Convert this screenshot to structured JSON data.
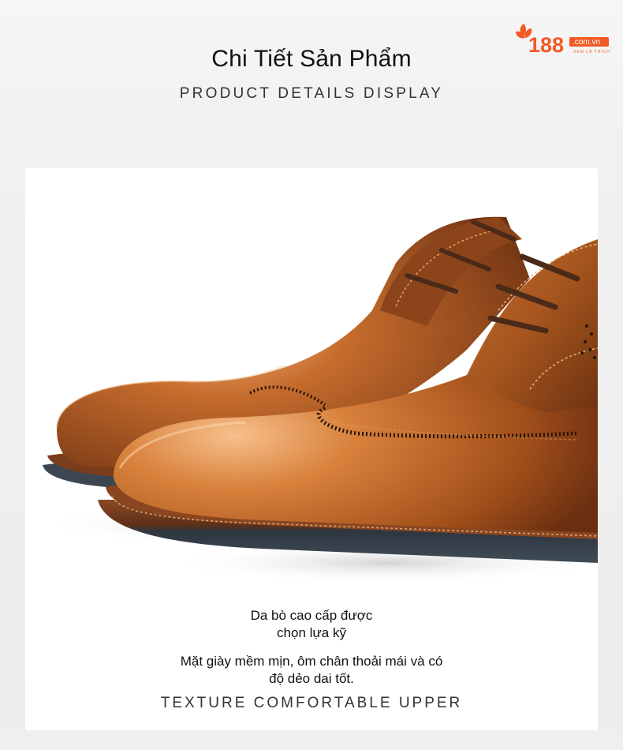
{
  "logo": {
    "brand_number": "188",
    "domain": ".com.vn",
    "tagline": "XEM LÀ THÍCH",
    "icon": "orange-leaf-icon"
  },
  "header": {
    "title": "Chi Tiết Sản Phẩm",
    "subtitle": "PRODUCT DETAILS DISPLAY"
  },
  "product": {
    "image": "brown-leather-derby-shoes",
    "caption_line1": "Da bò cao cấp được",
    "caption_line2": "chọn lựa kỹ",
    "description_line1": "Mặt giày mềm mịn, ôm chân thoải mái và có",
    "description_line2": "độ dẻo dai tốt.",
    "feature": "TEXTURE COMFORTABLE UPPER"
  },
  "colors": {
    "leather": "#9c4f1c",
    "leather_highlight": "#e09a5c",
    "sole": "#3a4550",
    "accent": "#f15a24"
  }
}
